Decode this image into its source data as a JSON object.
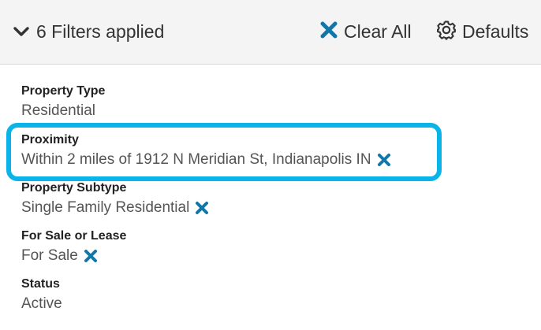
{
  "header": {
    "toggle_label": "6 Filters applied",
    "clear_all_label": "Clear All",
    "defaults_label": "Defaults"
  },
  "icons": {
    "toggle": "chevron-down-icon",
    "clear_all": "close-x-icon",
    "defaults": "gear-icon",
    "remove": "close-x-icon"
  },
  "colors": {
    "x_icon": "#1177a8",
    "highlight": "#0bb4e8",
    "header_bg": "#f4f4f4"
  },
  "filters": [
    {
      "title": "Property Type",
      "value": "Residential",
      "removable": false
    },
    {
      "title": "Proximity",
      "value": "Within 2 miles of 1912 N Meridian St, Indianapolis IN",
      "removable": true,
      "highlighted": true
    },
    {
      "title": "Property Subtype",
      "value": "Single Family Residential",
      "removable": true
    },
    {
      "title": "For Sale or Lease",
      "value": "For Sale",
      "removable": true
    },
    {
      "title": "Status",
      "value": "Active",
      "removable": false
    }
  ]
}
